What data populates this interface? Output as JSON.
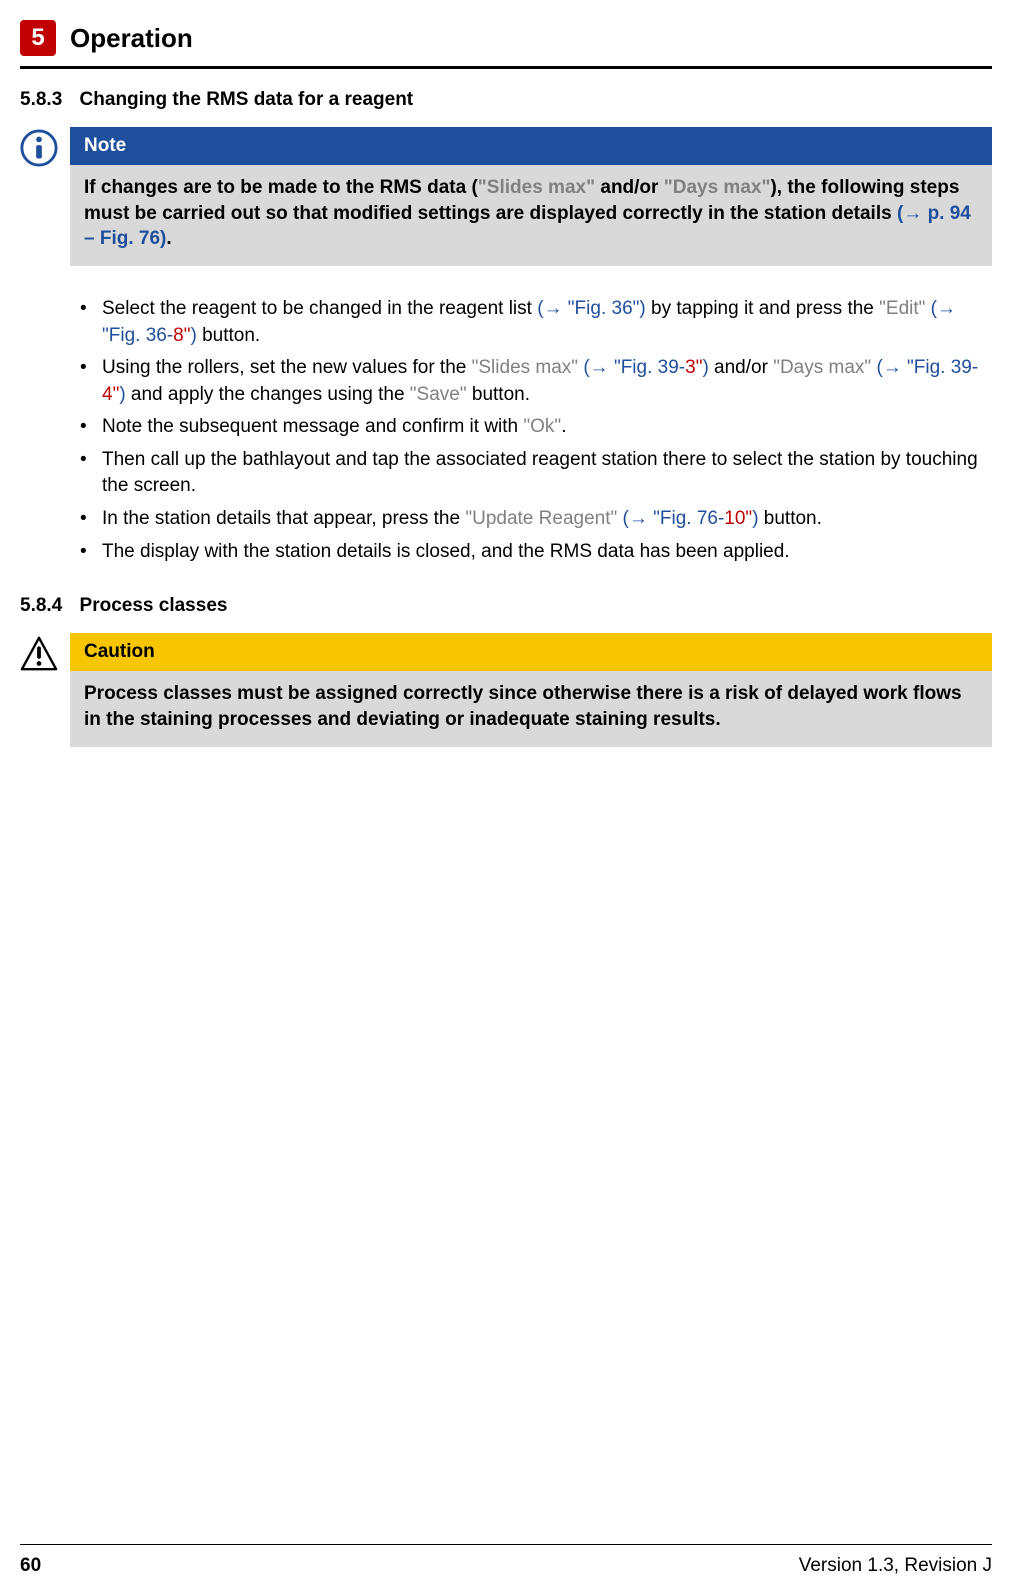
{
  "header": {
    "chapter_number": "5",
    "chapter_title": "Operation"
  },
  "section_583": {
    "number": "5.8.3",
    "title": "Changing the RMS data for a reagent"
  },
  "note": {
    "label": "Note",
    "t1": "If changes are to be made to the RMS data (",
    "slides_max": "\"Slides max\"",
    "t2": " and/or ",
    "days_max": "\"Days max\"",
    "t3": "), the following steps must be carried out so that modified settings are displayed correctly in the station details ",
    "ref": "(→ p. 94 – Fig. 76)",
    "t4": "."
  },
  "bullets": {
    "b1": {
      "a": "Select the reagent to be changed in the reagent list ",
      "ref1": "(→ \"Fig. 36\")",
      "b": " by tapping it and press the ",
      "edit": "\"Edit\"",
      "c": " ",
      "ref2_open": "(→ ",
      "ref2_fig": "\"Fig. 36",
      "ref2_dash": "-",
      "ref2_num": "8\"",
      "ref2_close": ")",
      "d": " button."
    },
    "b2": {
      "a": "Using the rollers, set the new values for the ",
      "slides_max": "\"Slides max\"",
      "b": " ",
      "ref1_open": "(→ ",
      "ref1_fig": "\"Fig. 39",
      "ref1_dash": "-",
      "ref1_num": "3\"",
      "ref1_close": ")",
      "c": " and/or ",
      "days_max": "\"Days max\"",
      "d": " ",
      "ref2_open": "(→ ",
      "ref2_fig": "\"Fig. 39",
      "ref2_dash": "-",
      "ref2_num": "4\"",
      "ref2_close": ")",
      "e": " and apply the changes using the ",
      "save": "\"Save\"",
      "f": " button."
    },
    "b3": {
      "a": "Note the subsequent message and confirm it with ",
      "ok": "\"Ok\"",
      "b": "."
    },
    "b4": {
      "a": "Then call up the bathlayout and tap the associated reagent station there to select the station by touching the screen."
    },
    "b5": {
      "a": "In the station details that appear, press the ",
      "update": "\"Update Reagent\"",
      "b": " ",
      "ref_open": "(→ ",
      "ref_fig": "\"Fig. 76",
      "ref_dash": "-",
      "ref_num": "10\"",
      "ref_close": ")",
      "c": " button."
    },
    "b6": {
      "a": "The display with the station details is closed, and the RMS data has been applied."
    }
  },
  "section_584": {
    "number": "5.8.4",
    "title": "Process classes"
  },
  "caution": {
    "label": "Caution",
    "text": "Process classes must be assigned correctly since otherwise there is a risk of delayed work flows in the staining processes and deviating or inadequate staining results."
  },
  "footer": {
    "page": "60",
    "version": "Version 1.3, Revision J"
  }
}
